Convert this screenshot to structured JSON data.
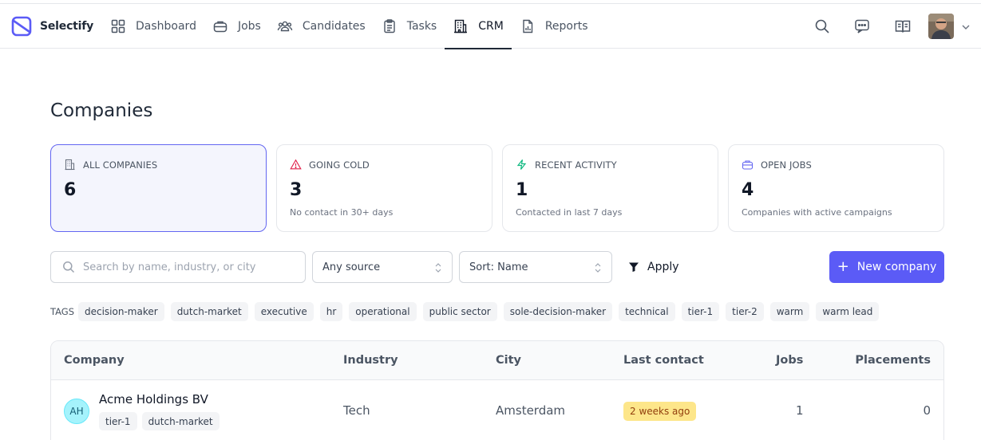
{
  "app": {
    "name": "Selectify"
  },
  "nav": {
    "items": [
      {
        "label": "Dashboard",
        "icon": "grid-icon"
      },
      {
        "label": "Jobs",
        "icon": "briefcase-icon"
      },
      {
        "label": "Candidates",
        "icon": "users-icon"
      },
      {
        "label": "Tasks",
        "icon": "clipboard-icon"
      },
      {
        "label": "CRM",
        "icon": "building-icon",
        "active": true
      },
      {
        "label": "Reports",
        "icon": "report-icon"
      }
    ]
  },
  "page": {
    "title": "Companies"
  },
  "stats": [
    {
      "label": "ALL COMPANIES",
      "value": "6",
      "sub": "",
      "icon": "building-icon"
    },
    {
      "label": "GOING COLD",
      "value": "3",
      "sub": "No contact in 30+ days",
      "icon": "warning-icon"
    },
    {
      "label": "RECENT ACTIVITY",
      "value": "1",
      "sub": "Contacted in last 7 days",
      "icon": "bolt-icon"
    },
    {
      "label": "OPEN JOBS",
      "value": "4",
      "sub": "Companies with active campaigns",
      "icon": "briefcase-icon"
    }
  ],
  "filters": {
    "search_placeholder": "Search by name, industry, or city",
    "search_value": "",
    "source": "Any source",
    "sort": "Sort: Name",
    "apply_label": "Apply",
    "new_label": "New company"
  },
  "tags": {
    "label": "TAGS",
    "items": [
      "decision-maker",
      "dutch-market",
      "executive",
      "hr",
      "operational",
      "public sector",
      "sole-decision-maker",
      "technical",
      "tier-1",
      "tier-2",
      "warm",
      "warm lead"
    ]
  },
  "table": {
    "columns": [
      "Company",
      "Industry",
      "City",
      "Last contact",
      "Jobs",
      "Placements"
    ],
    "rows": [
      {
        "initials": "AH",
        "name": "Acme Holdings BV",
        "tags": [
          "tier-1",
          "dutch-market"
        ],
        "industry": "Tech",
        "city": "Amsterdam",
        "last_contact": "2 weeks ago",
        "jobs": "1",
        "placements": "0"
      }
    ]
  },
  "colors": {
    "accent": "#5b5bf6",
    "active_card_bg": "#f4f5fd",
    "badge_bg": "#fde68a"
  }
}
